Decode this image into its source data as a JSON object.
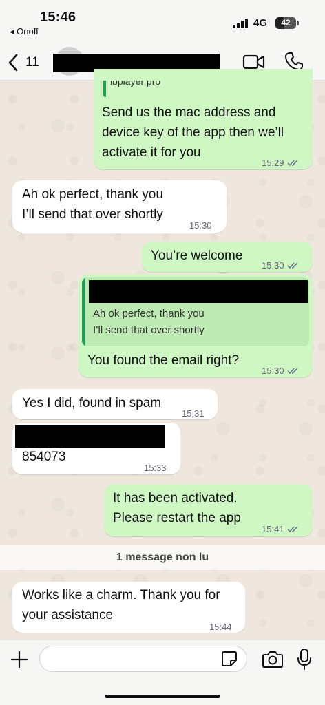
{
  "status_bar": {
    "time": "15:46",
    "back_app": "◂ Onoff",
    "network": "4G",
    "battery_level": 42,
    "battery_label": "42"
  },
  "header": {
    "unread_count": "11",
    "icons": [
      "back-chevron-icon",
      "video-icon",
      "phone-icon"
    ]
  },
  "messages": [
    {
      "direction": "outgoing",
      "quoted_preview": "ibplayer pro",
      "lines": [
        "Send us the mac address and",
        "device key of the app then we’ll",
        "activate it for you"
      ],
      "time": "15:29",
      "status": "read"
    },
    {
      "direction": "incoming",
      "lines": [
        "Ah ok perfect, thank you",
        "I’ll send that over shortly"
      ],
      "time": "15:30"
    },
    {
      "direction": "outgoing",
      "lines": [
        "You’re welcome"
      ],
      "time": "15:30",
      "status": "read"
    },
    {
      "direction": "outgoing",
      "quote": {
        "lines": [
          "Ah ok perfect, thank you",
          "I’ll send that over shortly"
        ]
      },
      "lines": [
        "You found the email right?"
      ],
      "time": "15:30",
      "status": "read"
    },
    {
      "direction": "incoming",
      "lines": [
        "Yes I did, found in spam"
      ],
      "time": "15:31"
    },
    {
      "direction": "incoming",
      "lines": [
        "854073"
      ],
      "time": "15:33"
    },
    {
      "direction": "outgoing",
      "lines": [
        "It has been activated.",
        "Please restart the app"
      ],
      "time": "15:41",
      "status": "read"
    },
    {
      "direction": "incoming",
      "lines": [
        "Works like a charm. Thank you for",
        "your assistance"
      ],
      "time": "15:44"
    }
  ],
  "unread_banner": "1 message non lu",
  "composer": {
    "placeholder": "",
    "icons": [
      "plus-icon",
      "sticker-icon",
      "camera-icon",
      "microphone-icon"
    ]
  },
  "colors": {
    "outgoing_bubble": "#cff7c4",
    "incoming_bubble": "#ffffff",
    "read_ticks": "#667788",
    "quote_bar": "#1f9d55"
  }
}
